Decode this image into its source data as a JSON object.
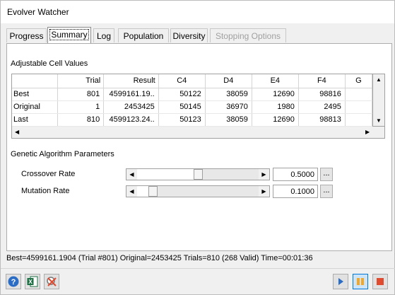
{
  "window": {
    "title": "Evolver Watcher"
  },
  "tabs": [
    {
      "label": "Progress",
      "state": "normal"
    },
    {
      "label": "Summary",
      "state": "active"
    },
    {
      "label": "Log",
      "state": "normal"
    },
    {
      "label": "Population",
      "state": "normal"
    },
    {
      "label": "Diversity",
      "state": "normal"
    },
    {
      "label": "Stopping Options",
      "state": "disabled"
    }
  ],
  "adjustable": {
    "title": "Adjustable Cell Values",
    "columns": [
      "",
      "Trial",
      "Result",
      "C4",
      "D4",
      "E4",
      "F4",
      "G"
    ],
    "rows": [
      [
        "Best",
        "801",
        "4599161.19..",
        "50122",
        "38059",
        "12690",
        "98816",
        ""
      ],
      [
        "Original",
        "1",
        "2453425",
        "50145",
        "36970",
        "1980",
        "2495",
        ""
      ],
      [
        "Last",
        "810",
        "4599123.24..",
        "50123",
        "38059",
        "12690",
        "98813",
        ""
      ]
    ]
  },
  "ga": {
    "title": "Genetic Algorithm Parameters",
    "crossover": {
      "label": "Crossover Rate",
      "value": "0.5000",
      "level": 0.5,
      "button": "..."
    },
    "mutation": {
      "label": "Mutation Rate",
      "value": "0.1000",
      "level": 0.1,
      "button": "..."
    }
  },
  "status": "Best=4599161.1904 (Trial #801) Original=2453425 Trials=810 (268 Valid) Time=00:01:36",
  "icons": {
    "help": "help-icon",
    "excel": "excel-icon",
    "clear": "clear-icon",
    "play": "play-icon",
    "pause": "pause-icon",
    "stop": "stop-icon"
  },
  "colors": {
    "accent_blue": "#2b6cc4",
    "pause_orange": "#f5a623",
    "stop_red": "#e04a2f",
    "excel_green": "#1e7145"
  }
}
